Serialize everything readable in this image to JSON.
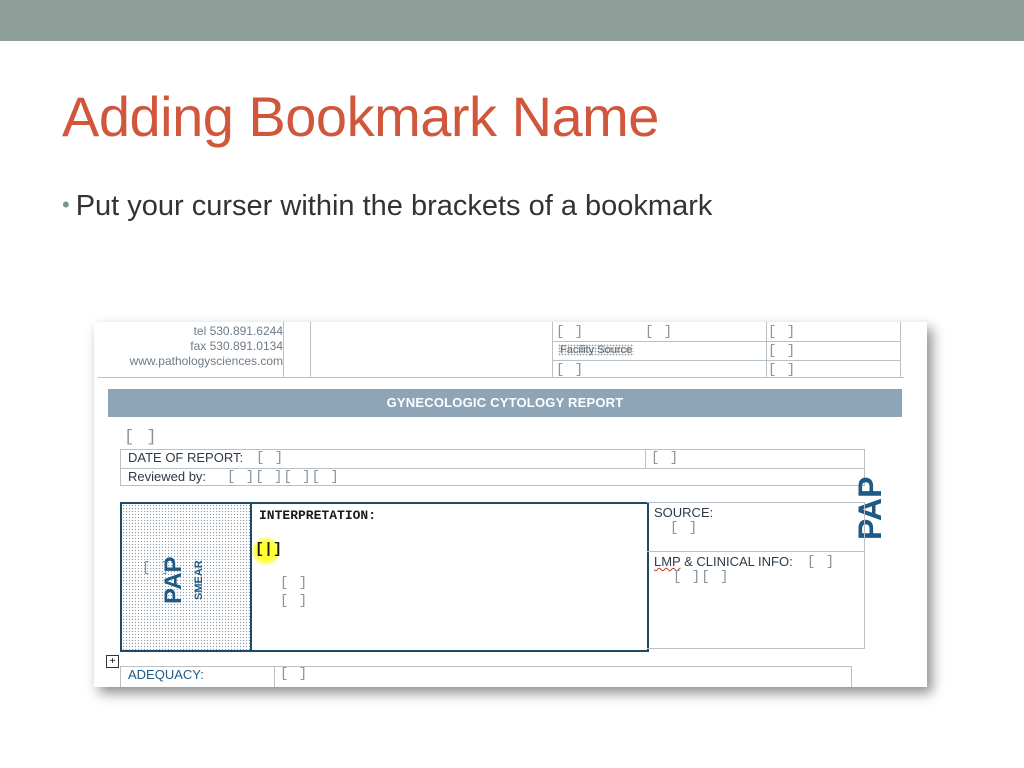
{
  "slide": {
    "title": "Adding Bookmark Name",
    "bullet": "Put your curser within the brackets of a bookmark",
    "bullet_marker": "•"
  },
  "colors": {
    "top_bar": "#8e9f99",
    "title": "#d0573c",
    "banner": "#8ea5b8",
    "box_border": "#1e4a66"
  },
  "doc": {
    "contact": {
      "tel": "tel 530.891.6244",
      "fax": "fax 530.891.0134",
      "web": "www.pathologysciences.com"
    },
    "header_brackets": [
      "[ ]",
      "[ ]",
      "[ ]",
      "[ ]",
      "[ ]",
      "[ ]"
    ],
    "facility_source": "Facility Source",
    "banner": "GYNECOLOGIC CYTOLOGY REPORT",
    "top_bracket": "[ ]",
    "date_of_report_label": "DATE OF REPORT:",
    "date_bracket": "[ ]",
    "date_right_bracket": "[ ]",
    "reviewed_by_label": "Reviewed by:",
    "reviewed_brackets": "[ ][ ][ ][ ]",
    "side_logo": "PAP",
    "box_pap": "PAP",
    "box_smear": "SMEAR",
    "box_left_bracket": "[ ]",
    "interpretation_label": "INTERPRETATION:",
    "cursor_bracket": "[|]",
    "interp_brackets": [
      "[ ]",
      "[ ]"
    ],
    "source_label": "SOURCE:",
    "source_bracket": "[ ]",
    "lmp_word": "LMP",
    "clinical_label": " & CLINICAL INFO:",
    "clinical_bracket": "[ ]",
    "clinical_sub_brackets": "[ ][ ]",
    "adequacy_label": "ADEQUACY:",
    "adequacy_bracket": "[ ]",
    "expand_icon": "+"
  }
}
